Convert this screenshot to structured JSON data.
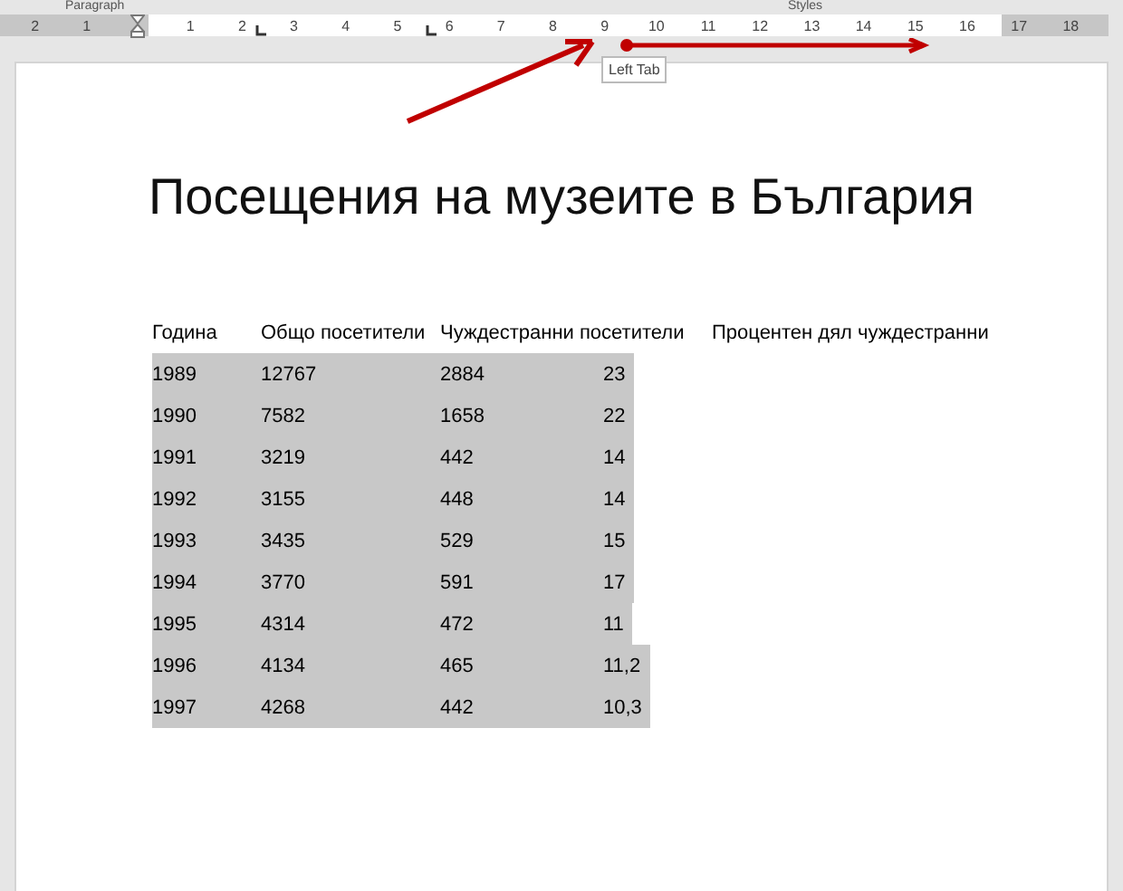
{
  "ribbon": {
    "groups": [
      "Paragraph",
      "Styles"
    ]
  },
  "ruler": {
    "left_numbers": [
      "2",
      "1"
    ],
    "numbers": [
      "1",
      "2",
      "3",
      "4",
      "5",
      "6",
      "7",
      "8",
      "9",
      "10",
      "11",
      "12",
      "13",
      "14",
      "15",
      "16",
      "17",
      "18"
    ]
  },
  "tooltip": "Left Tab",
  "document": {
    "title": "Посещения на музеите в България",
    "table": {
      "columns": [
        "Година",
        "Общо посетители",
        "Чуждестранни посетители",
        "Процентен дял чуждестранни"
      ],
      "rows": [
        {
          "cells": [
            "1989",
            "12767",
            "2884",
            "23"
          ],
          "selected": true
        },
        {
          "cells": [
            "1990",
            "7582",
            "1658",
            "22"
          ],
          "selected": true
        },
        {
          "cells": [
            "1991",
            "3219",
            "442",
            "14"
          ],
          "selected": true
        },
        {
          "cells": [
            "1992",
            "3155",
            "448",
            "14"
          ],
          "selected": true
        },
        {
          "cells": [
            "1993",
            "3435",
            "529",
            "15"
          ],
          "selected": true
        },
        {
          "cells": [
            "1994",
            "3770",
            "591",
            "17"
          ],
          "selected": true
        },
        {
          "cells": [
            "1995",
            "4314",
            "472",
            "11"
          ],
          "selected": true
        },
        {
          "cells": [
            "1996",
            "4134",
            "465",
            "11,2"
          ],
          "selected": true
        },
        {
          "cells": [
            "1997",
            "4268",
            "442",
            "10,3"
          ],
          "selected": true
        }
      ]
    }
  }
}
